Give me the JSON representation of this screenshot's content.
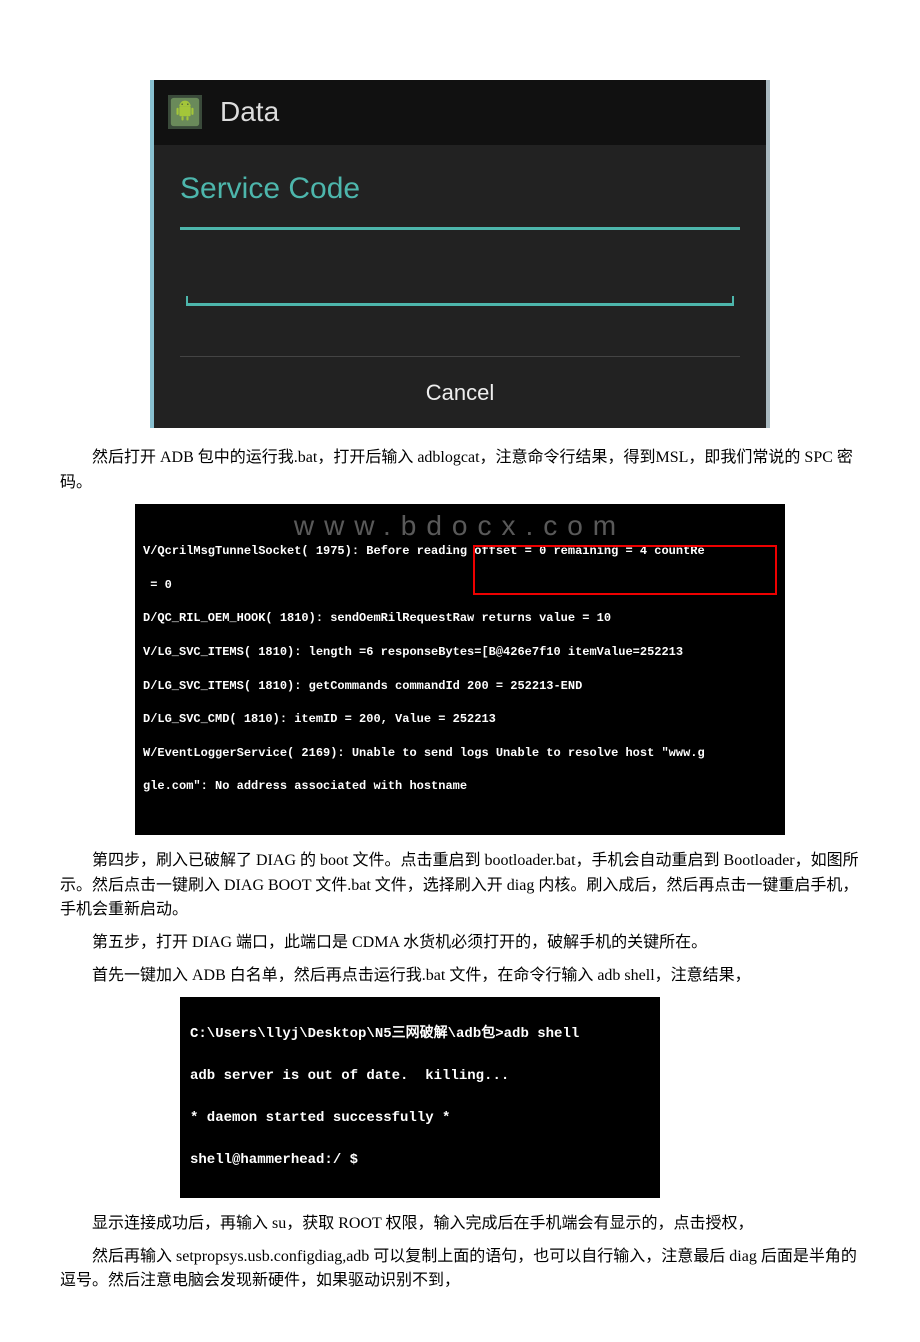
{
  "android": {
    "header_title": "Data",
    "dialog_title": "Service Code",
    "input_value": "",
    "cancel_label": "Cancel"
  },
  "paragraphs": {
    "p1": "然后打开 ADB 包中的运行我.bat，打开后输入 adblogcat，注意命令行结果，得到MSL，即我们常说的 SPC 密码。",
    "p2": "第四步，刷入已破解了 DIAG 的 boot 文件。点击重启到 bootloader.bat，手机会自动重启到 Bootloader，如图所示。然后点击一键刷入 DIAG BOOT 文件.bat 文件，选择刷入开 diag 内核。刷入成后，然后再点击一键重启手机，手机会重新启动。",
    "p3": "第五步，打开 DIAG 端口，此端口是 CDMA 水货机必须打开的，破解手机的关键所在。",
    "p4": "首先一键加入 ADB 白名单，然后再点击运行我.bat 文件，在命令行输入 adb shell，注意结果，",
    "p5": "显示连接成功后，再输入 su，获取 ROOT 权限，输入完成后在手机端会有显示的，点击授权，",
    "p6": "然后再输入 setpropsys.usb.configdiag,adb 可以复制上面的语句，也可以自行输入，注意最后 diag 后面是半角的逗号。然后注意电脑会发现新硬件，如果驱动识别不到，"
  },
  "terminal1": {
    "l1": "V/QcrilMsgTunnelSocket( 1975): Before reading offset = 0 remaining = 4 countRe",
    "l2": " = 0",
    "l3": "D/QC_RIL_OEM_HOOK( 1810): sendOemRilRequestRaw returns value = 10",
    "l4": "V/LG_SVC_ITEMS( 1810): length =6 responseBytes=[B@426e7f10 itemValue=252213",
    "l5": "D/LG_SVC_ITEMS( 1810): getCommands commandId 200 = 252213-END",
    "l6": "D/LG_SVC_CMD( 1810): itemID = 200, Value = 252213",
    "l7": "W/EventLoggerService( 2169): Unable to send logs Unable to resolve host \"www.g",
    "l8": "gle.com\": No address associated with hostname",
    "watermark": "www.bdocx.com"
  },
  "terminal2": {
    "l1": "C:\\Users\\llyj\\Desktop\\N5三网破解\\adb包>adb shell",
    "l2": "adb server is out of date.  killing...",
    "l3": "* daemon started successfully *",
    "l4": "shell@hammerhead:/ $"
  }
}
